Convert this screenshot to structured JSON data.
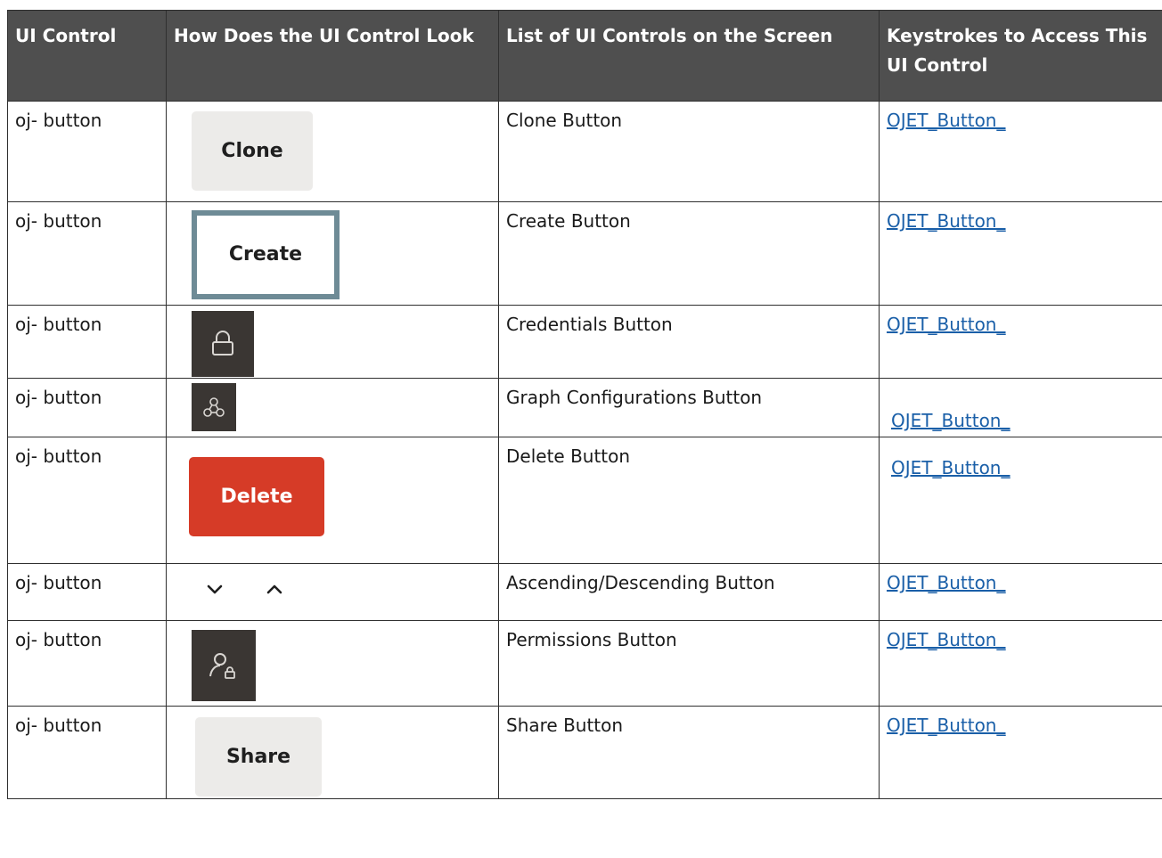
{
  "table": {
    "headers": [
      "UI Control",
      "How Does the UI Control Look",
      "List of UI Controls on the Screen",
      "Keystrokes to Access This UI Control"
    ],
    "rows": [
      {
        "control": "oj- button",
        "visual_label": "Clone",
        "visual_icon": "",
        "list": "Clone Button",
        "keystroke": "OJET_Button_"
      },
      {
        "control": "oj- button",
        "visual_label": "Create",
        "visual_icon": "",
        "list": "Create Button",
        "keystroke": "OJET_Button_"
      },
      {
        "control": "oj- button",
        "visual_label": "",
        "visual_icon": "lock-icon",
        "list": "Credentials Button",
        "keystroke": "OJET_Button_"
      },
      {
        "control": "oj- button",
        "visual_label": "",
        "visual_icon": "graph-nodes-icon",
        "list": "Graph Configurations Button",
        "keystroke": "OJET_Button_"
      },
      {
        "control": "oj- button",
        "visual_label": "Delete",
        "visual_icon": "",
        "list": "Delete Button",
        "keystroke": "OJET_Button_"
      },
      {
        "control": "oj- button",
        "visual_label": "",
        "visual_icon": "chevron-down-icon, chevron-up-icon",
        "list": "Ascending/Descending Button",
        "keystroke": "OJET_Button_"
      },
      {
        "control": "oj- button",
        "visual_label": "",
        "visual_icon": "user-lock-icon",
        "list": "Permissions Button",
        "keystroke": "OJET_Button_"
      },
      {
        "control": "oj- button",
        "visual_label": "Share",
        "visual_icon": "",
        "list": "Share Button",
        "keystroke": "OJET_Button_"
      }
    ]
  },
  "colors": {
    "header_bg": "#4f4f4f",
    "link": "#1a5fa8",
    "danger": "#d63b27",
    "dark_button": "#3a3633",
    "light_button": "#ecebe9",
    "outline_border": "#6e8b96"
  }
}
